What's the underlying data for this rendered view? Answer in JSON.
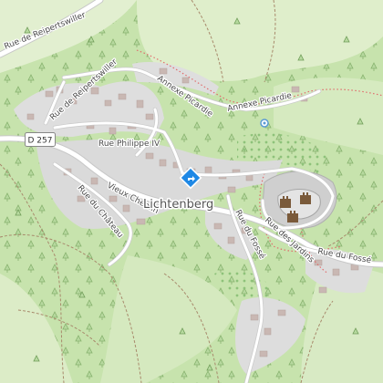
{
  "map": {
    "place_name": "Lichtenberg",
    "road_shield": "D 257",
    "streets": {
      "rue_reipertswiller_nw": "Rue de Reipertswiller",
      "rue_reipertswiller_w": "Rue de Reipertswiller",
      "annexe_picardie_1": "Annexe Picardie",
      "annexe_picardie_2": "Annexe Picardie",
      "rue_philippe": "Rue Philippe IV",
      "vieux_chemin": "Vieux Chemin",
      "rue_chateau": "Rue du Château",
      "rue_fosse_1": "Rue du Fossé",
      "rue_fosse_2": "Rue du Fossé",
      "rue_jardins": "Rue des Jardins"
    },
    "icons": {
      "directions": "directions-marker-icon",
      "castle": "castle-icon",
      "poi": "poi-circle-icon",
      "trees": "tree-icon"
    },
    "colors": {
      "forest": "#c2dfa6",
      "meadow": "#dcecc8",
      "residential": "#dcdcdc",
      "orchard": "#aed39a",
      "road": "#ffffff",
      "marker": "#1e88e5"
    }
  }
}
